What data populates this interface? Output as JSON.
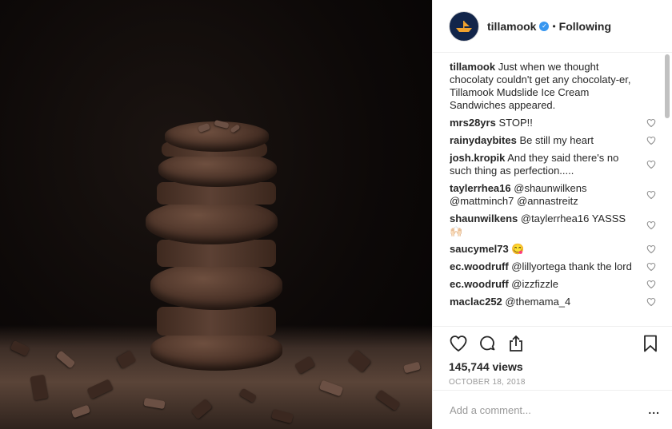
{
  "header": {
    "username": "tillamook",
    "separator": "•",
    "follow_status": "Following"
  },
  "caption": {
    "user": "tillamook",
    "text": "Just when we thought chocolaty couldn't get any chocolaty-er, Tillamook Mudslide Ice Cream Sandwiches appeared."
  },
  "comments": [
    {
      "user": "mrs28yrs",
      "text": "STOP!!"
    },
    {
      "user": "rainydaybites",
      "text": "Be still my heart"
    },
    {
      "user": "josh.kropik",
      "text": "And they said there's no such thing as perfection....."
    },
    {
      "user": "taylerrhea16",
      "text": "@shaunwilkens @mattminch7 @annastreitz"
    },
    {
      "user": "shaunwilkens",
      "text": "@taylerrhea16 YASSS 🙌🏻"
    },
    {
      "user": "saucymel73",
      "text": "😋"
    },
    {
      "user": "ec.woodruff",
      "text": "@lillyortega thank the lord"
    },
    {
      "user": "ec.woodruff",
      "text": "@izzfizzle"
    },
    {
      "user": "maclac252",
      "text": "@themama_4"
    }
  ],
  "stats": {
    "views": "145,744 views",
    "date": "OCTOBER 18, 2018"
  },
  "add_comment": {
    "placeholder": "Add a comment...",
    "more": "..."
  },
  "colors": {
    "text": "#262626",
    "muted": "#999999",
    "verified": "#3897f0",
    "border": "#efefef"
  }
}
